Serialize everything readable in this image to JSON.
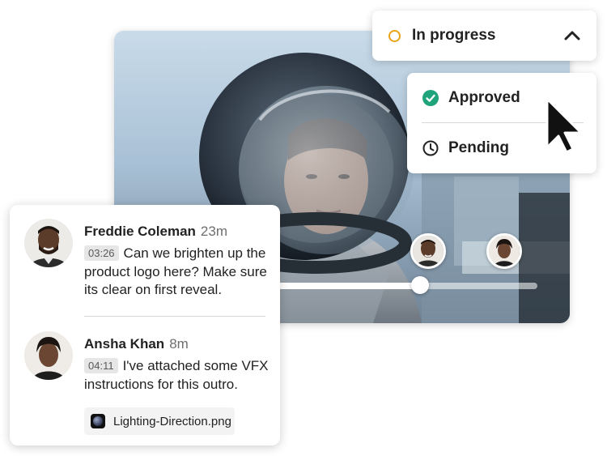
{
  "status": {
    "current_label": "In progress",
    "current_color": "#e8a317",
    "chevron_icon": "chevron-up-icon",
    "options": [
      {
        "label": "Approved",
        "icon": "check-circle-icon",
        "color": "#1fa37a"
      },
      {
        "label": "Pending",
        "icon": "clock-icon",
        "color": "#222222"
      }
    ]
  },
  "video": {
    "playhead_fraction": 0.55
  },
  "comments": [
    {
      "author": "Freddie Coleman",
      "time": "23m",
      "timecode": "03:26",
      "text": "Can we brighten up the product logo here? Make sure its clear on first reveal."
    },
    {
      "author": "Ansha Khan",
      "time": "8m",
      "timecode": "04:11",
      "text": "I've attached some VFX instructions for this outro.",
      "attachment": "Lighting-Direction.png"
    }
  ]
}
